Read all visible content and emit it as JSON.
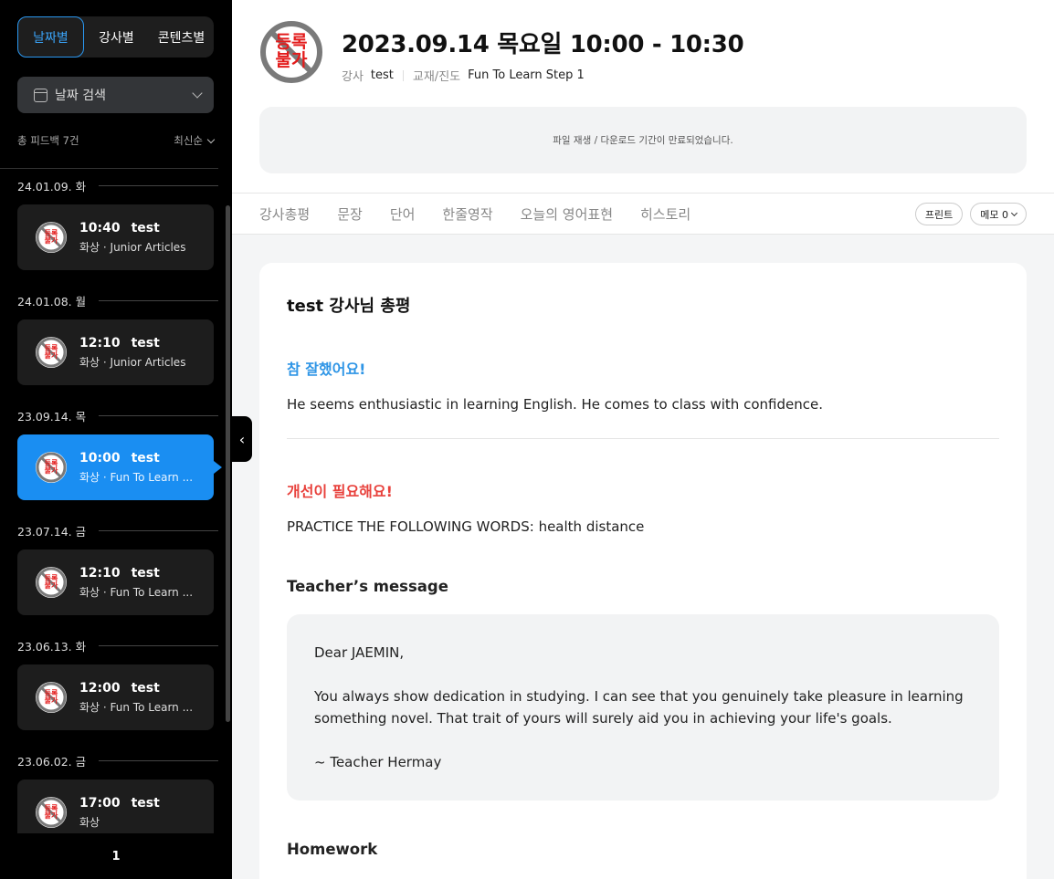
{
  "sidebar": {
    "segments": [
      "날짜별",
      "강사별",
      "콘텐츠별"
    ],
    "date_search_label": "날짜 검색",
    "total_label": "총 피드백 7건",
    "sort_label": "최신순",
    "groups": [
      {
        "date": "24.01.09. 화",
        "time": "10:40",
        "teacher": "test",
        "sub": "화상 · Junior Articles"
      },
      {
        "date": "24.01.08. 월",
        "time": "12:10",
        "teacher": "test",
        "sub": "화상 · Junior Articles"
      },
      {
        "date": "23.09.14. 목",
        "time": "10:00",
        "teacher": "test",
        "sub": "화상 · Fun To Learn ..."
      },
      {
        "date": "23.07.14. 금",
        "time": "12:10",
        "teacher": "test",
        "sub": "화상 · Fun To Learn ..."
      },
      {
        "date": "23.06.13. 화",
        "time": "12:00",
        "teacher": "test",
        "sub": "화상 · Fun To Learn ..."
      },
      {
        "date": "23.06.02. 금",
        "time": "17:00",
        "teacher": "test",
        "sub": "화상"
      }
    ],
    "page": "1"
  },
  "badge": {
    "line1": "등록",
    "line2": "불가",
    "color": "#e31b1b"
  },
  "header": {
    "title": "2023.09.14 목요일  10:00 - 10:30",
    "teacher_label": "강사",
    "teacher_value": "test",
    "material_label": "교재/진도",
    "material_value": "Fun To Learn Step 1",
    "notice": "파일 재생 / 다운로드 기간이 만료되었습니다."
  },
  "tabs": [
    "강사총평",
    "문장",
    "단어",
    "한줄영작",
    "오늘의 영어표현",
    "히스토리"
  ],
  "tools": {
    "print": "프린트",
    "memo": "메모 0"
  },
  "content": {
    "title": "test 강사님 총평",
    "good_heading": "참 잘했어요!",
    "good_text": "He seems enthusiastic in learning English. He comes to class with confidence.",
    "bad_heading": "개선이 필요해요!",
    "bad_text": "PRACTICE THE FOLLOWING WORDS: health distance",
    "message_heading": "Teacher’s message",
    "message_greeting": "Dear JAEMIN,",
    "message_body_1": "You always show dedication in studying. I can see that you genuinely take pleasure in learning",
    "message_body_2": "something novel. That trait of yours will surely aid you in achieving your life's goals.",
    "message_sign": "~ Teacher Hermay",
    "homework_heading": "Homework"
  },
  "colors": {
    "accent": "#1a8ef2",
    "good": "#2e95e6",
    "bad": "#e8413c"
  }
}
